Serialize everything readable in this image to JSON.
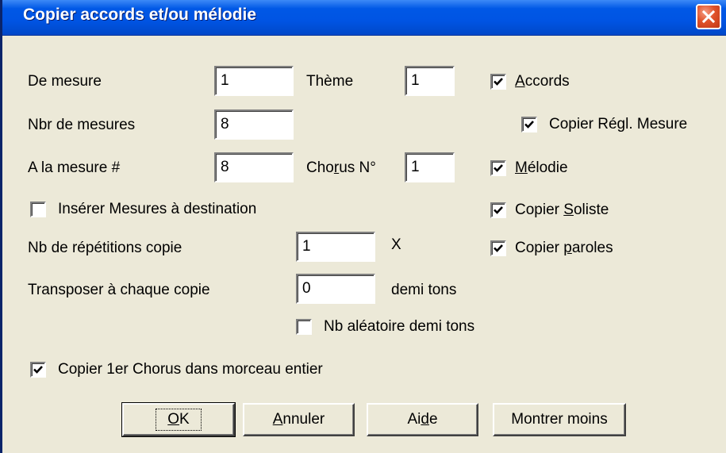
{
  "window": {
    "title": "Copier accords et/ou mélodie"
  },
  "fields": {
    "de_mesure": {
      "label": "De mesure",
      "value": "1"
    },
    "theme": {
      "label": "Thème",
      "value": "1"
    },
    "nbr_de_mesures": {
      "label": "Nbr de mesures",
      "value": "8"
    },
    "a_la_mesure": {
      "label": "A la mesure #",
      "value": "8"
    },
    "chorus_no": {
      "label_pre": "Cho",
      "label_u": "r",
      "label_post": "us N°",
      "value": "1"
    },
    "nb_repetitions": {
      "label": "Nb de répétitions copie",
      "value": "1",
      "suffix": "X"
    },
    "transposer": {
      "label": "Transposer à chaque copie",
      "value": "0",
      "suffix": "demi tons"
    }
  },
  "checkboxes": {
    "accords": {
      "u": "A",
      "rest": "ccords",
      "checked": true
    },
    "copier_regl_mesure": {
      "label": "Copier Régl. Mesure",
      "checked": true
    },
    "melodie": {
      "u": "M",
      "rest": "élodie",
      "checked": true
    },
    "inserer_mesures": {
      "label": "Insérer Mesures à destination",
      "checked": false
    },
    "copier_soliste": {
      "pre": "Copier ",
      "u": "S",
      "rest": "oliste",
      "checked": true
    },
    "copier_paroles": {
      "pre": "Copier ",
      "u": "p",
      "rest": "aroles",
      "checked": true
    },
    "nb_aleatoire": {
      "label": "Nb aléatoire demi tons",
      "checked": false
    },
    "copier_1er_chorus": {
      "label": "Copier 1er Chorus dans morceau entier",
      "checked": true
    }
  },
  "buttons": {
    "ok": {
      "u": "O",
      "rest": "K"
    },
    "annuler": {
      "u": "A",
      "rest": "nnuler"
    },
    "aide": {
      "pre": "Ai",
      "u": "d",
      "rest": "e"
    },
    "montrer_moins": {
      "label": "Montrer moins"
    }
  },
  "icons": {
    "close": "close-x-icon",
    "check": "checkmark-icon"
  },
  "colors": {
    "titlebar": "#0054e3",
    "close": "#e0522a",
    "dialog_bg": "#ece9d8"
  }
}
